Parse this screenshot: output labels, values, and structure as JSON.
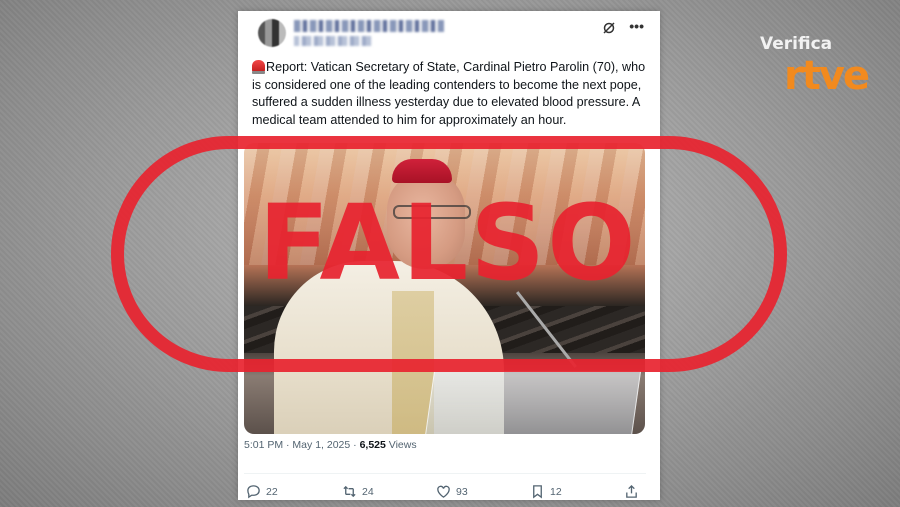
{
  "tweet": {
    "text": "Report: Vatican Secretary of State, Cardinal Pietro Parolin (70), who is considered one of the leading contenders to become the next pope, suffered a sudden illness yesterday due to elevated blood pressure. A medical team attended to him for approximately an hour.",
    "timestamp": "5:01 PM · May 1, 2025 · ",
    "views_count": "6,525",
    "views_label": " Views",
    "actions": {
      "replies": "22",
      "reposts": "24",
      "likes": "93",
      "bookmarks": "12"
    }
  },
  "overlay": {
    "stamp_text": "FALSO"
  },
  "brand": {
    "top": "Verifica",
    "bottom": "rtve",
    "color": "#f28a1e"
  },
  "colors": {
    "stamp": "#e8232f"
  }
}
